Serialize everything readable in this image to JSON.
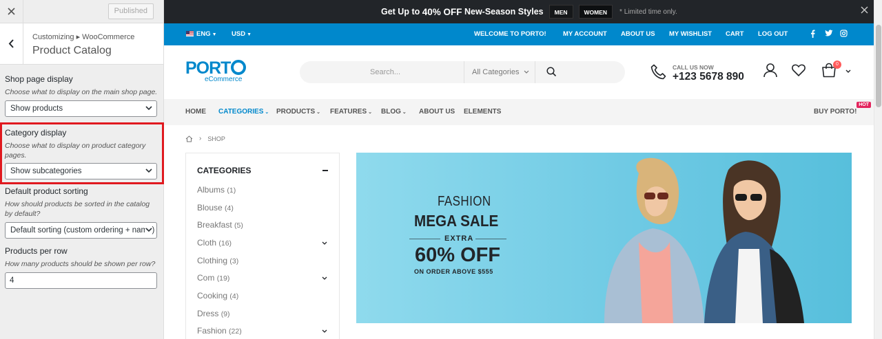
{
  "customizer": {
    "published_label": "Published",
    "breadcrumb": "Customizing ▸ WooCommerce",
    "title": "Product Catalog",
    "shop_display": {
      "label": "Shop page display",
      "description": "Choose what to display on the main shop page.",
      "value": "Show products"
    },
    "category_display": {
      "label": "Category display",
      "description": "Choose what to display on product category pages.",
      "value": "Show subcategories"
    },
    "sorting": {
      "label": "Default product sorting",
      "description": "How should products be sorted in the catalog by default?",
      "value": "Default sorting (custom ordering + name)"
    },
    "per_row": {
      "label": "Products per row",
      "description": "How many products should be shown per row?",
      "value": "4"
    }
  },
  "promo": {
    "text_prefix": "Get Up to",
    "text_highlight": "40% OFF",
    "text_suffix": "New-Season Styles",
    "tag_men": "MEN",
    "tag_women": "WOMEN",
    "note": "* Limited time only."
  },
  "topbar": {
    "language": "ENG",
    "currency": "USD",
    "welcome": "WELCOME TO PORTO!",
    "my_account": "MY ACCOUNT",
    "about_us": "ABOUT US",
    "wishlist": "MY WISHLIST",
    "cart": "CART",
    "logout": "LOG OUT"
  },
  "header": {
    "logo": "PORT",
    "logo_sub": "eCommerce",
    "search_placeholder": "Search...",
    "search_category": "All Categories",
    "call_label": "CALL US NOW",
    "phone": "+123 5678 890",
    "cart_count": "0"
  },
  "nav": {
    "home": "HOME",
    "categories": "CATEGORIES",
    "products": "PRODUCTS",
    "features": "FEATURES",
    "blog": "BLOG",
    "about": "ABOUT US",
    "elements": "ELEMENTS",
    "buy": "BUY PORTO!",
    "hot": "HOT"
  },
  "breadcrumb": {
    "current": "SHOP"
  },
  "sidebar": {
    "title": "CATEGORIES",
    "items": [
      {
        "name": "Albums",
        "count": "(1)"
      },
      {
        "name": "Blouse",
        "count": "(4)"
      },
      {
        "name": "Breakfast",
        "count": "(5)"
      },
      {
        "name": "Cloth",
        "count": "(16)"
      },
      {
        "name": "Clothing",
        "count": "(3)"
      },
      {
        "name": "Com",
        "count": "(19)"
      },
      {
        "name": "Cooking",
        "count": "(4)"
      },
      {
        "name": "Dress",
        "count": "(9)"
      },
      {
        "name": "Fashion",
        "count": "(22)"
      }
    ]
  },
  "banner": {
    "fashion": "FASHION",
    "mega": "MEGA SALE",
    "extra": "EXTRA",
    "off": "60% OFF",
    "order": "ON ORDER ABOVE $555"
  },
  "colors": {
    "accent": "#0088cc",
    "dark": "#222529",
    "highlight": "#e0191f"
  }
}
